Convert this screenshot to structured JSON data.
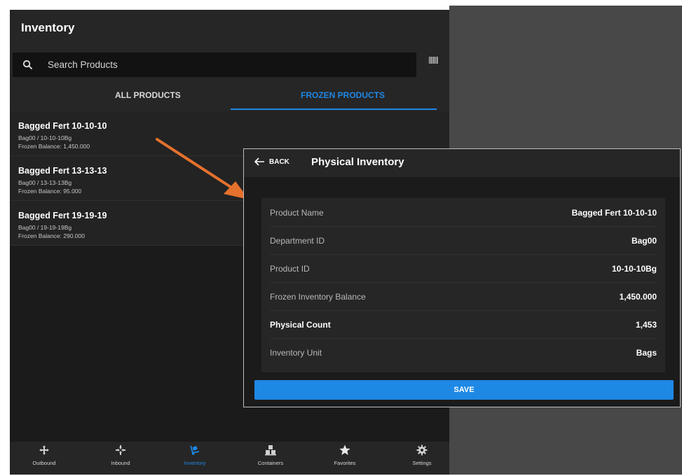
{
  "app": {
    "title": "Inventory",
    "search_placeholder": "Search Products",
    "tabs": [
      {
        "label": "ALL PRODUCTS",
        "active": false
      },
      {
        "label": "FROZEN PRODUCTS",
        "active": true
      }
    ],
    "products": [
      {
        "name": "Bagged Fert 10-10-10",
        "sub": "Bag00 / 10-10-10Bg",
        "balance": "Frozen Balance: 1,450.000"
      },
      {
        "name": "Bagged Fert 13-13-13",
        "sub": "Bag00 / 13-13-13Bg",
        "balance": "Frozen Balance: 95.000"
      },
      {
        "name": "Bagged Fert 19-19-19",
        "sub": "Bag00 / 19-19-19Bg",
        "balance": "Frozen Balance: 290.000"
      }
    ],
    "nav": [
      {
        "label": "Outbound",
        "icon": "move-arrows-icon",
        "active": false
      },
      {
        "label": "Inbound",
        "icon": "inbound-arrows-icon",
        "active": false
      },
      {
        "label": "Inventory",
        "icon": "hand-truck-icon",
        "active": true
      },
      {
        "label": "Containers",
        "icon": "containers-icon",
        "active": false
      },
      {
        "label": "Favorites",
        "icon": "star-icon",
        "active": false
      },
      {
        "label": "Settings",
        "icon": "gear-icon",
        "active": false
      }
    ]
  },
  "dialog": {
    "back_label": "BACK",
    "title": "Physical Inventory",
    "rows": [
      {
        "label": "Product Name",
        "value": "Bagged Fert 10-10-10"
      },
      {
        "label": "Department ID",
        "value": "Bag00"
      },
      {
        "label": "Product ID",
        "value": "10-10-10Bg"
      },
      {
        "label": "Frozen Inventory Balance",
        "value": "1,450.000"
      },
      {
        "label": "Physical Count",
        "value": "1,453"
      },
      {
        "label": "Inventory Unit",
        "value": "Bags"
      }
    ],
    "save_label": "SAVE"
  },
  "colors": {
    "accent": "#1e88e5",
    "annotation_arrow": "#e4712d",
    "background": "#1b1b1b",
    "surface": "#262626"
  }
}
